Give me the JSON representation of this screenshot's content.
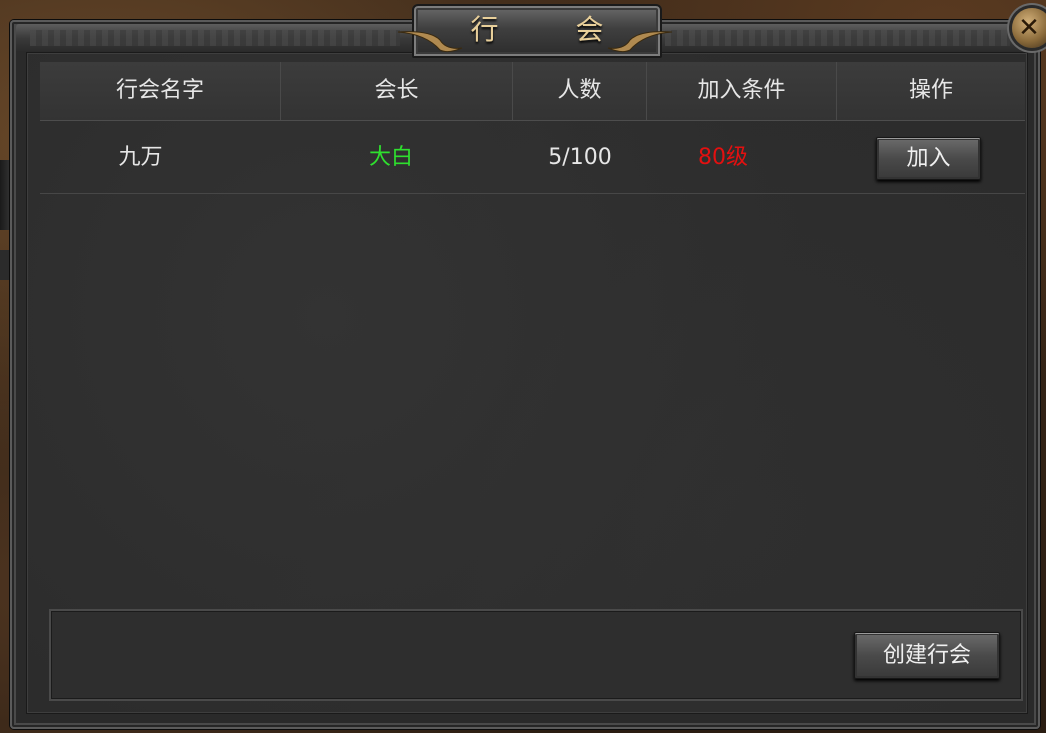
{
  "window": {
    "title": "行 会",
    "close_symbol": "✕"
  },
  "table": {
    "columns": [
      "行会名字",
      "会长",
      "人数",
      "加入条件",
      "操作"
    ],
    "rows": [
      {
        "guild_name": "九万",
        "leader": "大白",
        "members": "5/100",
        "requirement": "80级",
        "action_label": "加入"
      }
    ]
  },
  "footer": {
    "create_label": "创建行会"
  },
  "colors": {
    "leader": "#2ee02e",
    "requirement": "#e31010",
    "title": "#e8cf9a"
  },
  "icons": {
    "close": "close-icon"
  }
}
